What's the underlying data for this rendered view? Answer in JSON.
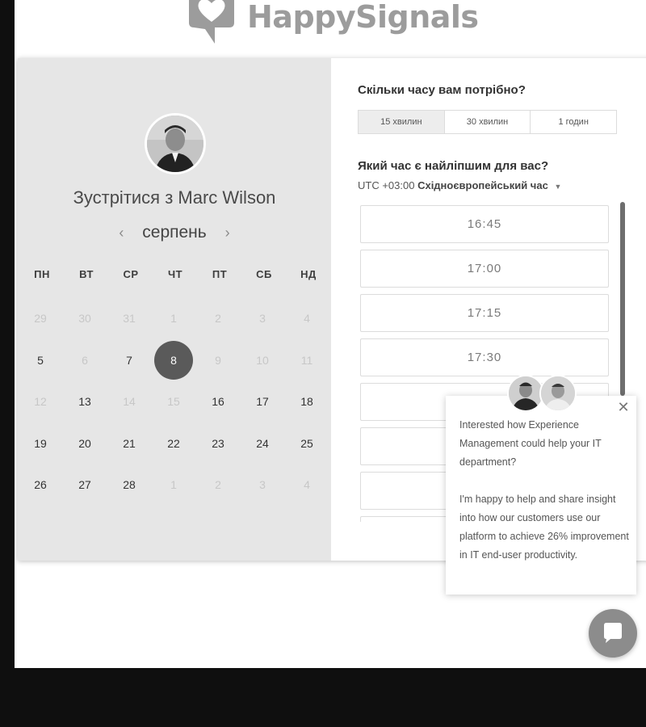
{
  "brand": {
    "name": "HappySignals",
    "logo_icon": "heart-speech-bubble-icon"
  },
  "scheduler": {
    "meeting_title": "Зустрітися з Marc Wilson",
    "host_avatar_icon": "host-avatar",
    "calendar": {
      "month": "серпень",
      "prev_icon": "chevron-left-icon",
      "next_icon": "chevron-right-icon",
      "weekdays": [
        "ПН",
        "ВТ",
        "СР",
        "ЧТ",
        "ПТ",
        "СБ",
        "НД"
      ],
      "weeks": [
        [
          "29",
          "30",
          "31",
          "1",
          "2",
          "3",
          "4"
        ],
        [
          "5",
          "6",
          "7",
          "8",
          "9",
          "10",
          "11"
        ],
        [
          "12",
          "13",
          "14",
          "15",
          "16",
          "17",
          "18"
        ],
        [
          "19",
          "20",
          "21",
          "22",
          "23",
          "24",
          "25"
        ],
        [
          "26",
          "27",
          "28",
          "1",
          "2",
          "3",
          "4"
        ]
      ],
      "available": [
        [
          false,
          false,
          false,
          false,
          false,
          false,
          false
        ],
        [
          true,
          false,
          true,
          true,
          false,
          false,
          false
        ],
        [
          false,
          true,
          false,
          false,
          true,
          true,
          true
        ],
        [
          true,
          true,
          true,
          true,
          true,
          true,
          true
        ],
        [
          true,
          true,
          true,
          false,
          false,
          false,
          false
        ]
      ],
      "selected_day": "8"
    },
    "duration_question": "Скільки часу вам потрібно?",
    "durations": [
      "15 хвилин",
      "30 хвилин",
      "1 годин"
    ],
    "selected_duration": "15 хвилин",
    "time_question": "Який час є найліпшим для вас?",
    "timezone_offset": "UTC +03:00",
    "timezone_name": "Східноєвропейський час",
    "slots": [
      "16:45",
      "17:00",
      "17:15",
      "17:30",
      "",
      "",
      "",
      ""
    ]
  },
  "chat": {
    "message_line1": "Interested how Experience Management could help your IT department?",
    "message_line2": "I'm happy to help and share insight into how our customers use our platform to achieve 26% improvement in IT end-user productivity.",
    "close_icon": "close-icon",
    "launcher_icon": "chat-bubble-icon"
  }
}
